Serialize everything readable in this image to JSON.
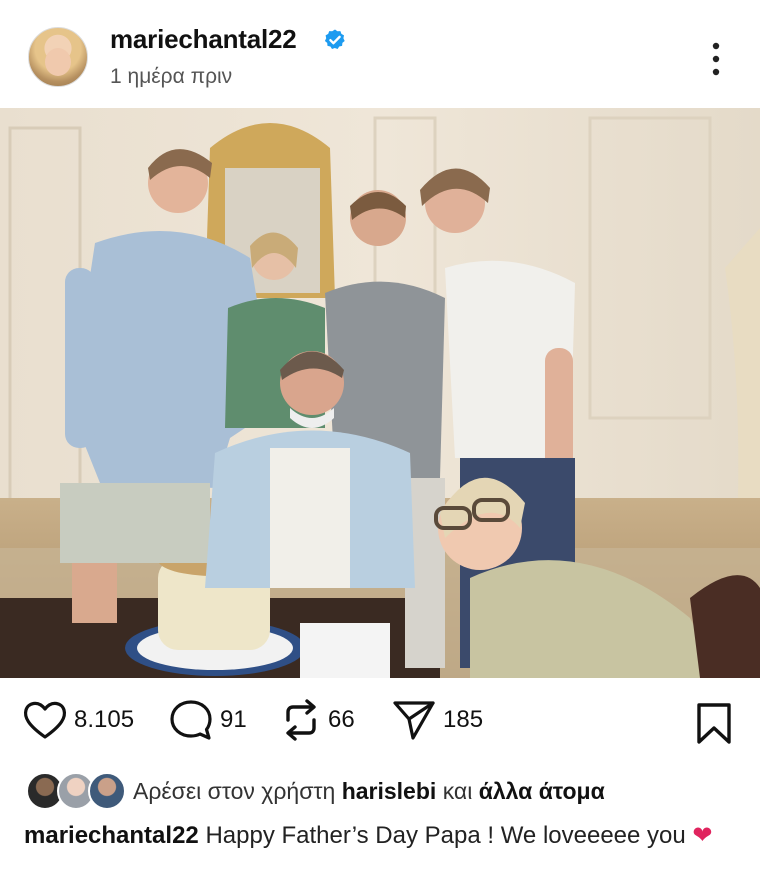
{
  "post": {
    "username": "mariechantal22",
    "time": "1 ημέρα πριν"
  },
  "actions": {
    "likes": "8.105",
    "comments": "91",
    "reposts": "66",
    "shares": "185"
  },
  "liked_by": {
    "prefix": "Αρέσει στον χρήστη",
    "user": "harislebi",
    "connector": "και",
    "others": "άλλα άτομα"
  },
  "caption": {
    "username": "mariechantal22",
    "text": "Happy Father’s Day Papa ! We loveeeee you",
    "emoji": "❤"
  },
  "colors": {
    "verified": "#1d9bf0",
    "heart_emoji": "#e0245e"
  },
  "icons": [
    "verified-badge-icon",
    "more-options-icon",
    "heart-icon",
    "comment-icon",
    "repost-icon",
    "share-icon",
    "bookmark-icon"
  ]
}
